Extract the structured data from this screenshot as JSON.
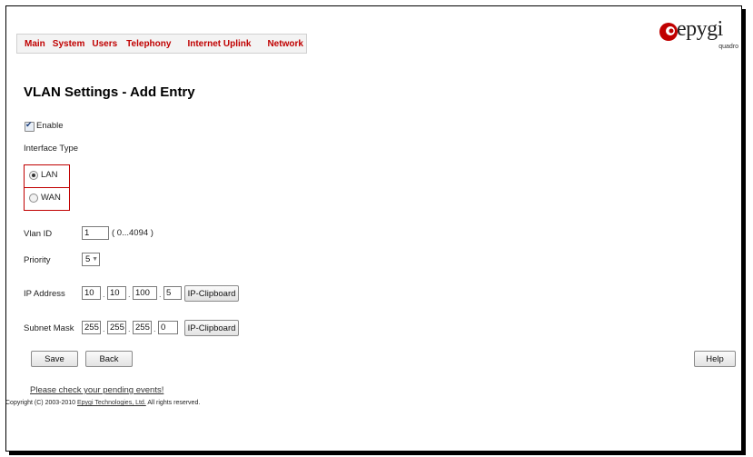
{
  "menu": [
    "Main",
    "System",
    "Users",
    "Telephony",
    "Internet Uplink",
    "Network"
  ],
  "logo": {
    "word": "epygi",
    "sub": "quadro",
    "color": "#c00000"
  },
  "page_title": "VLAN Settings - Add Entry",
  "enable": {
    "label": "Enable",
    "checked": true
  },
  "interface_type": {
    "label": "Interface Type",
    "options": [
      {
        "label": "LAN",
        "selected": true
      },
      {
        "label": "WAN",
        "selected": false
      }
    ]
  },
  "vlan_id": {
    "label": "Vlan ID",
    "value": "1",
    "range": "( 0...4094 )"
  },
  "priority": {
    "label": "Priority",
    "value": "5"
  },
  "ip_address": {
    "label": "IP Address",
    "octets": [
      "10",
      "10",
      "100",
      "5"
    ],
    "button": "IP-Clipboard"
  },
  "subnet_mask": {
    "label": "Subnet Mask",
    "octets": [
      "255",
      "255",
      "255",
      "0"
    ],
    "button": "IP-Clipboard"
  },
  "buttons": {
    "save": "Save",
    "back": "Back",
    "help": "Help"
  },
  "pending_link": "Please check your pending events!",
  "copyright": {
    "prefix": "Copyright (C) 2003-2010 ",
    "company": "Epygi Technologies, Ltd.",
    "suffix": " All rights reserved."
  }
}
